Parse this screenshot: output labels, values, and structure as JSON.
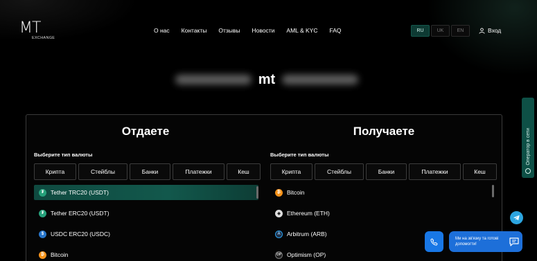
{
  "brand": {
    "mark": "MT",
    "sub": "EXCHANGE"
  },
  "nav": [
    {
      "label": "О нас"
    },
    {
      "label": "Контакты"
    },
    {
      "label": "Отзывы"
    },
    {
      "label": "Новости"
    },
    {
      "label": "AML & KYC"
    },
    {
      "label": "FAQ"
    }
  ],
  "languages": [
    {
      "code": "RU",
      "active": true
    },
    {
      "code": "UK",
      "active": false
    },
    {
      "code": "EN",
      "active": false
    }
  ],
  "login_label": "Вход",
  "hero": {
    "visible_word": "mt"
  },
  "give": {
    "title": "Отдаете",
    "type_label": "Выберите тип валюты",
    "tabs": [
      "Крипта",
      "Стейблы",
      "Банки",
      "Платежки",
      "Кеш"
    ],
    "items": [
      {
        "label": "Tether TRC20 (USDT)",
        "icon": "tether-icon",
        "selected": true
      },
      {
        "label": "Tether ERC20 (USDT)",
        "icon": "tether-icon",
        "selected": false
      },
      {
        "label": "USDC ERC20 (USDC)",
        "icon": "usdc-icon",
        "selected": false
      },
      {
        "label": "Bitcoin",
        "icon": "bitcoin-icon",
        "selected": false
      }
    ]
  },
  "receive": {
    "title": "Получаете",
    "type_label": "Выберите тип валюты",
    "tabs": [
      "Крипта",
      "Стейблы",
      "Банки",
      "Платежки",
      "Кеш"
    ],
    "items": [
      {
        "label": "Bitcoin",
        "icon": "bitcoin-icon"
      },
      {
        "label": "Ethereum (ETH)",
        "icon": "ethereum-icon"
      },
      {
        "label": "Arbitrum (ARB)",
        "icon": "arbitrum-icon"
      },
      {
        "label": "Optimism (OP)",
        "icon": "optimism-icon"
      }
    ]
  },
  "side_tab": {
    "label": "Оператор в сети"
  },
  "chat": {
    "message": "Ми на зв'язку та готові допомогти!"
  },
  "colors": {
    "accent": "#12584c",
    "chat_blue": "#1d6fd9",
    "telegram": "#2ca5e0"
  }
}
